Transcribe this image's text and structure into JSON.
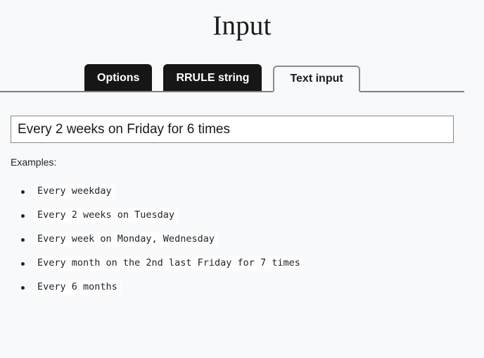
{
  "header": {
    "title": "Input"
  },
  "tabs": {
    "items": [
      {
        "label": "Options",
        "active": false
      },
      {
        "label": "RRULE string",
        "active": false
      },
      {
        "label": "Text input",
        "active": true
      }
    ]
  },
  "main": {
    "text_input": {
      "value": "Every 2 weeks on Friday for 6 times",
      "placeholder": ""
    },
    "examples_label": "Examples:",
    "examples": [
      "Every weekday",
      "Every 2 weeks on Tuesday",
      "Every week on Monday, Wednesday",
      "Every month on the 2nd last Friday for 7 times",
      "Every 6 months"
    ]
  },
  "colors": {
    "page_background": "#f8f9fa",
    "tab_inactive_background": "#161616",
    "tab_inactive_text": "#ffffff",
    "tab_active_text": "#1a1a1a",
    "tab_border": "#868e96",
    "input_border": "#8a8a8a",
    "input_background": "#ffffff",
    "code_chip_background": "#fdfdfd",
    "text": "#212529"
  }
}
